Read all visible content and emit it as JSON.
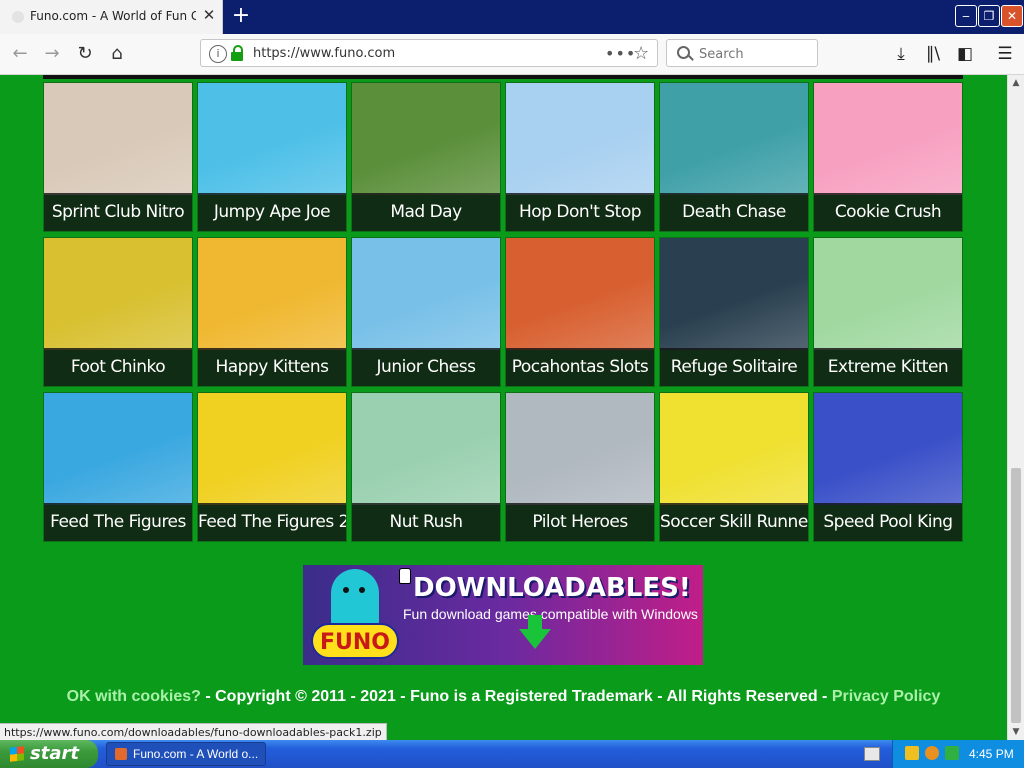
{
  "browser": {
    "tab_title": "Funo.com - A World of Fun Games",
    "tab_close": "✕",
    "new_tab": "+",
    "url": "https://www.funo.com",
    "url_more": "•••",
    "search_placeholder": "Search",
    "window_controls": [
      "‒",
      "❐",
      "✕"
    ]
  },
  "games": [
    {
      "title": "Sprint Club Nitro",
      "color": "#d9c9b8"
    },
    {
      "title": "Jumpy Ape Joe",
      "color": "#4ec0e8"
    },
    {
      "title": "Mad Day",
      "color": "#5b8f3a"
    },
    {
      "title": "Hop Don't Stop",
      "color": "#a8d0f0"
    },
    {
      "title": "Death Chase",
      "color": "#3fa0a8"
    },
    {
      "title": "Cookie Crush",
      "color": "#f7a0c0"
    },
    {
      "title": "Foot Chinko",
      "color": "#d8c030"
    },
    {
      "title": "Happy Kittens",
      "color": "#f0b830"
    },
    {
      "title": "Junior Chess",
      "color": "#78c0e8"
    },
    {
      "title": "Pocahontas Slots",
      "color": "#d86030"
    },
    {
      "title": "Refuge Solitaire",
      "color": "#2a4050"
    },
    {
      "title": "Extreme Kitten",
      "color": "#a0d8a0"
    },
    {
      "title": "Feed The Figures",
      "color": "#3aa8e0"
    },
    {
      "title": "Feed The Figures 2",
      "color": "#f0d020"
    },
    {
      "title": "Nut Rush",
      "color": "#9ad0b0"
    },
    {
      "title": "Pilot Heroes",
      "color": "#b0b8c0"
    },
    {
      "title": "Soccer Skill Runner",
      "color": "#f0e030"
    },
    {
      "title": "Speed Pool King",
      "color": "#3a50c8"
    }
  ],
  "banner": {
    "logo": "FUNO",
    "heading": "DOWNLOADABLES!",
    "subtitle": "Fun download games compatible with Windows"
  },
  "footer": {
    "cookies": "OK with cookies?",
    "copyright": " - Copyright © 2011 - 2021 - Funo is a Registered Trademark - All Rights Reserved - ",
    "privacy": "Privacy Policy"
  },
  "status_url": "https://www.funo.com/downloadables/funo-downloadables-pack1.zip",
  "taskbar": {
    "start": "start",
    "task_item": "Funo.com - A World o...",
    "clock": "4:45 PM"
  }
}
